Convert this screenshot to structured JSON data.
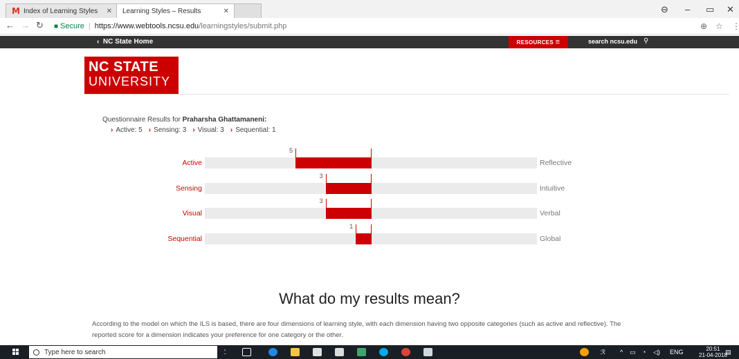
{
  "browser": {
    "tabs": [
      {
        "title": "Index of Learning Styles"
      },
      {
        "title": "Learning Styles – Results"
      },
      {
        "title": ""
      }
    ],
    "secure_label": "Secure",
    "url_host": "https://www.webtools.ncsu.edu",
    "url_path": "/learningstyles/submit.php"
  },
  "site": {
    "home_link": "NC State Home",
    "resources_label": "RESOURCES",
    "search_label": "search ncsu.edu",
    "logo_line1": "NC STATE",
    "logo_line2": "UNIVERSITY"
  },
  "results": {
    "title_prefix": "Questionnaire Results for",
    "name": "Praharsha Ghattamaneni:",
    "summary": [
      "Active: 5",
      "Sensing: 3",
      "Visual: 3",
      "Sequential: 1"
    ],
    "dimensions": [
      {
        "left": "Active",
        "right": "Reflective",
        "score": 5,
        "side": "left"
      },
      {
        "left": "Sensing",
        "right": "Intuitive",
        "score": 3,
        "side": "left"
      },
      {
        "left": "Visual",
        "right": "Verbal",
        "score": 3,
        "side": "left"
      },
      {
        "left": "Sequential",
        "right": "Global",
        "score": 1,
        "side": "left"
      }
    ],
    "scale_max": 11
  },
  "meaning": {
    "heading": "What do my results mean?",
    "paragraph": "According to the model on which the ILS is based, there are four dimensions of learning style, with each dimension having two opposite categories (such as active and reflective). The reported score for a dimension indicates your preference for one category or the other."
  },
  "taskbar": {
    "search_placeholder": "Type here to search",
    "lang": "ENG",
    "time": "20:51",
    "date": "21-04-2018"
  },
  "colors": {
    "accent": "#cc0000",
    "track": "#ebebeb",
    "topbar": "#333333"
  }
}
